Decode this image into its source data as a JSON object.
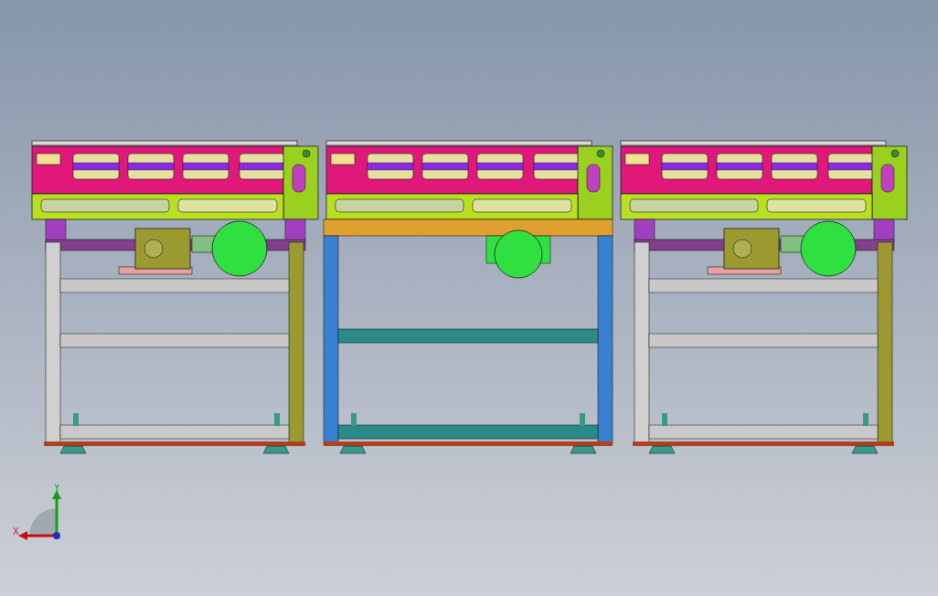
{
  "viewport": {
    "modules": [
      {
        "kind": "twin-motor"
      },
      {
        "kind": "single-motor"
      },
      {
        "kind": "twin-motor"
      }
    ],
    "triad": {
      "x_label": "X",
      "y_label": "Y"
    }
  }
}
